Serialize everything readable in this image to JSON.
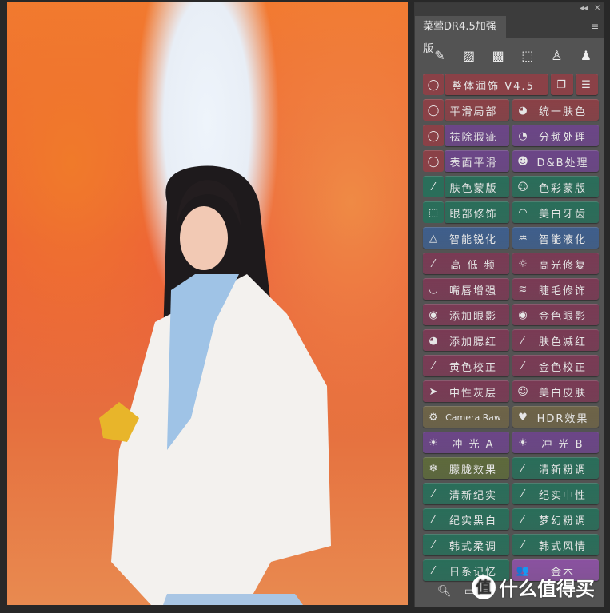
{
  "panel": {
    "title": "菜莺DR4.5加强版",
    "collapse_icon": "double-chevron-left-icon",
    "close_icon": "close-icon",
    "menu_icon": "hamburger-icon"
  },
  "tools": [
    {
      "icon": "brush-icon",
      "glyph": "✎"
    },
    {
      "icon": "bandage-select-icon",
      "glyph": "▨"
    },
    {
      "icon": "bandage-icon",
      "glyph": "▩"
    },
    {
      "icon": "selection-icon",
      "glyph": "⬚"
    },
    {
      "icon": "stamp-icon",
      "glyph": "♙"
    },
    {
      "icon": "pattern-stamp-icon",
      "glyph": "♟"
    }
  ],
  "main_row": {
    "label": "整体润饰 V4.5",
    "color": "#8a4147",
    "extra_icons": [
      "layers-icon",
      "sliders-icon"
    ]
  },
  "rows": [
    {
      "lasso": true,
      "left": {
        "label": "平滑局部",
        "color": "#8a4147"
      },
      "right": {
        "label": "统一肤色",
        "color": "#8a4147",
        "icon": "face-icon",
        "glyph": "◕"
      }
    },
    {
      "lasso": true,
      "left": {
        "label": "祛除瑕疵",
        "color": "#6c4688"
      },
      "right": {
        "label": "分频处理",
        "color": "#6c4688",
        "icon": "face-split-icon",
        "glyph": "◔"
      }
    },
    {
      "lasso": true,
      "left": {
        "label": "表面平滑",
        "color": "#6c4688"
      },
      "right": {
        "label": "D&B处理",
        "color": "#6c4688",
        "icon": "face-dodge-burn-icon",
        "glyph": "☻"
      }
    },
    {
      "lasso": "dropper",
      "left": {
        "label": "肤色蒙版",
        "color": "#2a6e5a"
      },
      "right": {
        "label": "色彩蒙版",
        "color": "#2a6e5a",
        "icon": "masks-icon",
        "glyph": "☺"
      }
    },
    {
      "lasso": "select",
      "left": {
        "label": "眼部修饰",
        "color": "#2a6e5a"
      },
      "right": {
        "label": "美白牙齿",
        "color": "#2a6e5a",
        "icon": "teeth-icon",
        "glyph": "◠"
      }
    },
    {
      "left": {
        "label": "智能锐化",
        "color": "#3f5f8c",
        "icon": "sharpen-icon",
        "glyph": "△"
      },
      "right": {
        "label": "智能液化",
        "color": "#3f5f8c",
        "icon": "liquify-face-icon",
        "glyph": "♒"
      }
    },
    {
      "left": {
        "label": "高 低 频",
        "color": "#7a3b55",
        "icon": "magic-wand-icon",
        "glyph": "⁄"
      },
      "right": {
        "label": "高光修复",
        "color": "#7a3b55",
        "icon": "sun-icon",
        "glyph": "☼"
      }
    },
    {
      "left": {
        "label": "嘴唇增强",
        "color": "#7a3b55",
        "icon": "lips-icon",
        "glyph": "◡"
      },
      "right": {
        "label": "睫毛修饰",
        "color": "#7a3b55",
        "icon": "eyelash-icon",
        "glyph": "≋"
      }
    },
    {
      "left": {
        "label": "添加眼影",
        "color": "#7a3b55",
        "icon": "eye-icon",
        "glyph": "◉"
      },
      "right": {
        "label": "金色眼影",
        "color": "#7a3b55",
        "icon": "eye-icon",
        "glyph": "◉"
      }
    },
    {
      "left": {
        "label": "添加腮红",
        "color": "#7a3b55",
        "icon": "blush-face-icon",
        "glyph": "◕"
      },
      "right": {
        "label": "肤色减红",
        "color": "#7a3b55",
        "icon": "dropper-icon",
        "glyph": "⁄"
      }
    },
    {
      "left": {
        "label": "黄色校正",
        "color": "#7a3b55",
        "icon": "dropper-icon",
        "glyph": "⁄"
      },
      "right": {
        "label": "金色校正",
        "color": "#7a3b55",
        "icon": "dropper-icon",
        "glyph": "⁄"
      }
    },
    {
      "left": {
        "label": "中性灰层",
        "color": "#7a3b55",
        "icon": "paper-plane-icon",
        "glyph": "➤"
      },
      "right": {
        "label": "美白皮肤",
        "color": "#7a3b55",
        "icon": "masks-icon",
        "glyph": "☺"
      }
    },
    {
      "left": {
        "label": "Camera Raw",
        "color": "#6e6448",
        "icon": "gear-icon",
        "glyph": "⚙"
      },
      "right": {
        "label": "HDR效果",
        "color": "#6e6448",
        "icon": "heart-icon",
        "glyph": "♥"
      }
    },
    {
      "left": {
        "label": "冲 光 A",
        "color": "#6c4688",
        "icon": "sun-icon",
        "glyph": "☀"
      },
      "right": {
        "label": "冲 光 B",
        "color": "#6c4688",
        "icon": "sun-icon",
        "glyph": "☀"
      }
    },
    {
      "left": {
        "label": "朦胧效果",
        "color": "#5e6a3c",
        "icon": "snowflake-icon",
        "glyph": "❄"
      },
      "right": {
        "label": "清新粉调",
        "color": "#2a6e5a",
        "icon": "magic-wand-icon",
        "glyph": "⁄"
      }
    },
    {
      "left": {
        "label": "清新纪实",
        "color": "#2a6e5a",
        "icon": "magic-wand-icon",
        "glyph": "⁄"
      },
      "right": {
        "label": "纪实中性",
        "color": "#2a6e5a",
        "icon": "magic-wand-icon",
        "glyph": "⁄"
      }
    },
    {
      "left": {
        "label": "纪实黑白",
        "color": "#2a6e5a",
        "icon": "magic-wand-icon",
        "glyph": "⁄"
      },
      "right": {
        "label": "梦幻粉调",
        "color": "#2a6e5a",
        "icon": "magic-wand-icon",
        "glyph": "⁄"
      }
    },
    {
      "left": {
        "label": "韩式柔调",
        "color": "#2a6e5a",
        "icon": "magic-wand-icon",
        "glyph": "⁄"
      },
      "right": {
        "label": "韩式风情",
        "color": "#2a6e5a",
        "icon": "magic-wand-icon",
        "glyph": "⁄"
      }
    },
    {
      "left": {
        "label": "日系记忆",
        "color": "#2a6e5a",
        "icon": "magic-wand-icon",
        "glyph": "⁄"
      },
      "right": {
        "label": "金木",
        "color": "#8a52a0",
        "icon": "users-icon",
        "glyph": "👥"
      }
    }
  ],
  "bottom_icons": [
    "search-icon",
    "panel-icon"
  ],
  "watermark": {
    "logo": "值",
    "text": "什么值得买"
  }
}
